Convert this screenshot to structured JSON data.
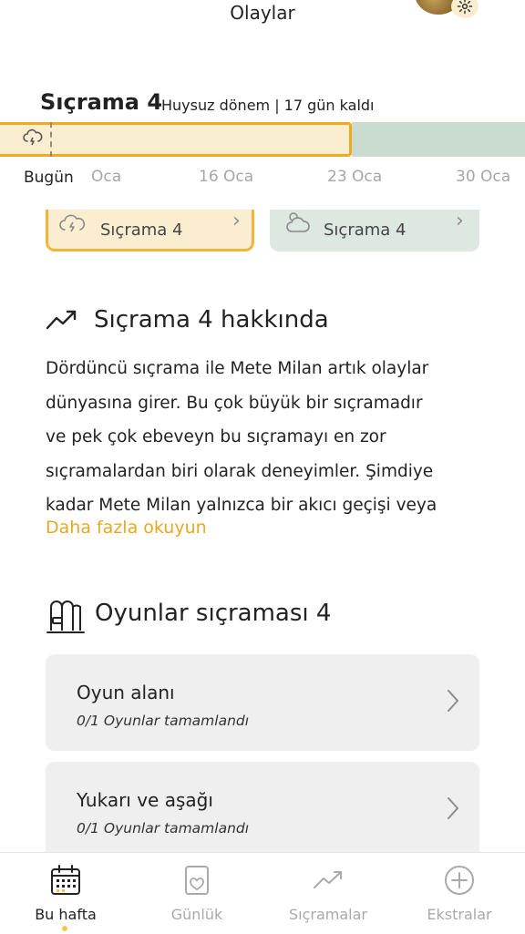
{
  "header": {
    "title": "Olaylar"
  },
  "leap": {
    "title": "Sıçrama 4",
    "subtitle": "Huysuz dönem | 17 gün kaldı"
  },
  "timeline": {
    "today_label": "Bugün",
    "dates": [
      "Oca",
      "16 Oca",
      "23 Oca",
      "30 Oca"
    ]
  },
  "leap_cards": [
    {
      "label": "Sıçrama 4",
      "state": "active",
      "icon": "storm-cloud-icon"
    },
    {
      "label": "Sıçrama 4",
      "state": "next",
      "icon": "sun-cloud-icon"
    }
  ],
  "about": {
    "title": "Sıçrama 4 hakkında",
    "lines": [
      "Dördüncü sıçrama ile Mete Milan artık olaylar",
      "dünyasına girer. Bu çok büyük bir sıçramadır",
      "ve pek çok ebeveyn bu sıçramayı en zor",
      "sıçramalardan biri olarak deneyimler. Şimdiye",
      "kadar Mete Milan yalnızca bir akıcı geçişi veya"
    ],
    "read_more": "Daha fazla okuyun"
  },
  "games": {
    "title": "Oyunlar sıçraması 4",
    "items": [
      {
        "name": "Oyun alanı",
        "progress": "0/1 Oyunlar tamamlandı"
      },
      {
        "name": "Yukarı ve aşağı",
        "progress": "0/1 Oyunlar tamamlandı"
      }
    ]
  },
  "bottom_nav": {
    "items": [
      {
        "label": "Bu hafta",
        "icon": "calendar-icon",
        "active": true
      },
      {
        "label": "Günlük",
        "icon": "diary-icon",
        "active": false
      },
      {
        "label": "Sıçramalar",
        "icon": "trend-icon",
        "active": false
      },
      {
        "label": "Ekstralar",
        "icon": "plus-circle-icon",
        "active": false
      }
    ]
  },
  "colors": {
    "accent": "#f0a91c",
    "accent_light": "#fbeed0",
    "next_leap": "#c9dccf",
    "link": "#e8a826"
  }
}
